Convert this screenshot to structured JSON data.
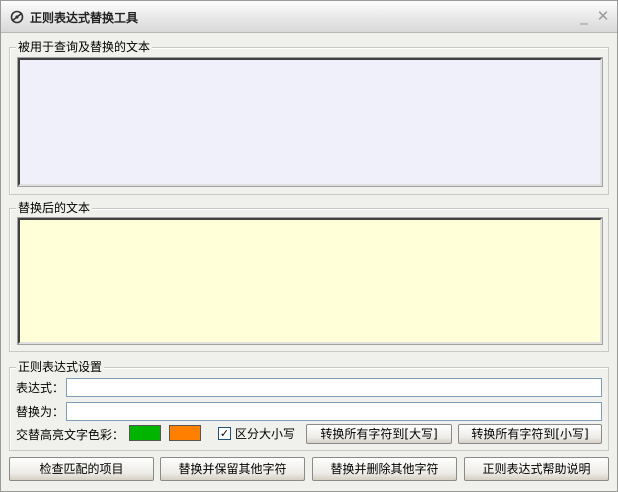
{
  "window": {
    "title": "正则表达式替换工具",
    "minimize_glyph": "_",
    "close_glyph": "✕",
    "icon": "app-icon"
  },
  "source_group": {
    "label": "被用于查询及替换的文本",
    "value": ""
  },
  "result_group": {
    "label": "替换后的文本",
    "value": ""
  },
  "settings_group": {
    "label": "正则表达式设置",
    "expression_label": "表达式：",
    "expression_value": "",
    "replace_label": "替换为：",
    "replace_value": "",
    "highlight_label": "交替高亮文字色彩：",
    "highlight_colors": [
      "#00b400",
      "#ff8000"
    ],
    "case_sensitive_label": "区分大小写",
    "case_sensitive_checked": true,
    "check_glyph": "✓",
    "upper_button": "转换所有字符到[大写]",
    "lower_button": "转换所有字符到[小写]"
  },
  "colors": {
    "source_bg": "#f0f0fa",
    "result_bg": "#ffffd8"
  },
  "actions": {
    "check_matches": "检查匹配的项目",
    "replace_keep": "替换并保留其他字符",
    "replace_delete": "替换并删除其他字符",
    "help": "正则表达式帮助说明"
  }
}
